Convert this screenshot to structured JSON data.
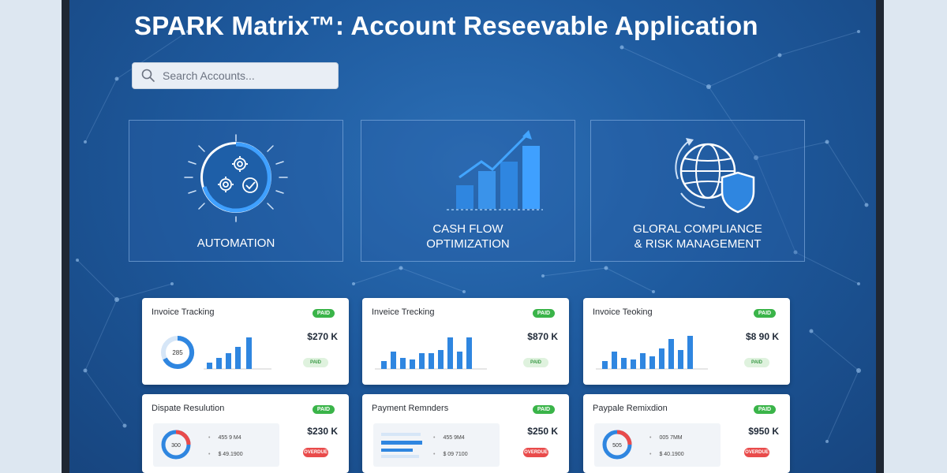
{
  "app": {
    "title": "SPARK Matrix™: Account Reseevable Application"
  },
  "search": {
    "placeholder": "Search Accounts...",
    "icon": "search-icon"
  },
  "colors": {
    "background": "#1e5a9e",
    "accent": "#2f80e0",
    "badge_green": "#3ab449",
    "badge_red": "#e94b4b"
  },
  "features": [
    {
      "label_line1": "AUTOMATION",
      "label_line2": "",
      "icon": "automation-gears-icon"
    },
    {
      "label_line1": "CASH FLOW",
      "label_line2": "OPTIMIZATION",
      "icon": "growth-chart-icon"
    },
    {
      "label_line1": "GLORAL COMPLIANCE",
      "label_line2": "& RISK MANAGEMENT",
      "icon": "globe-shield-icon"
    }
  ],
  "cards": [
    {
      "title": "Invoice Tracking",
      "badge": "PAID",
      "amount": "$270 K",
      "status": "PAID",
      "donut_label": "285"
    },
    {
      "title": "Inveice Trecking",
      "badge": "PAID",
      "amount": "$870 K",
      "status": "PAID"
    },
    {
      "title": "Invoice Teoking",
      "badge": "PAID",
      "amount": "$8 90 K",
      "status": "PAID"
    },
    {
      "title": "Dispate Resulution",
      "badge": "PAID",
      "amount": "$230 K",
      "status": "OVERDUE",
      "donut_label": "300",
      "line1": "455 9 M4",
      "line2": "$ 49.1900"
    },
    {
      "title": "Payment Remnders",
      "badge": "PAID",
      "amount": "$250 K",
      "status": "OVERDUE",
      "line1": "455 9M4",
      "line2": "$ 09 7100"
    },
    {
      "title": "Paypale Remixdion",
      "badge": "PAID",
      "amount": "$950 K",
      "status": "OVERDUE",
      "donut_label": "505",
      "line1": "005 7MM",
      "line2": "$ 40.1900"
    }
  ]
}
